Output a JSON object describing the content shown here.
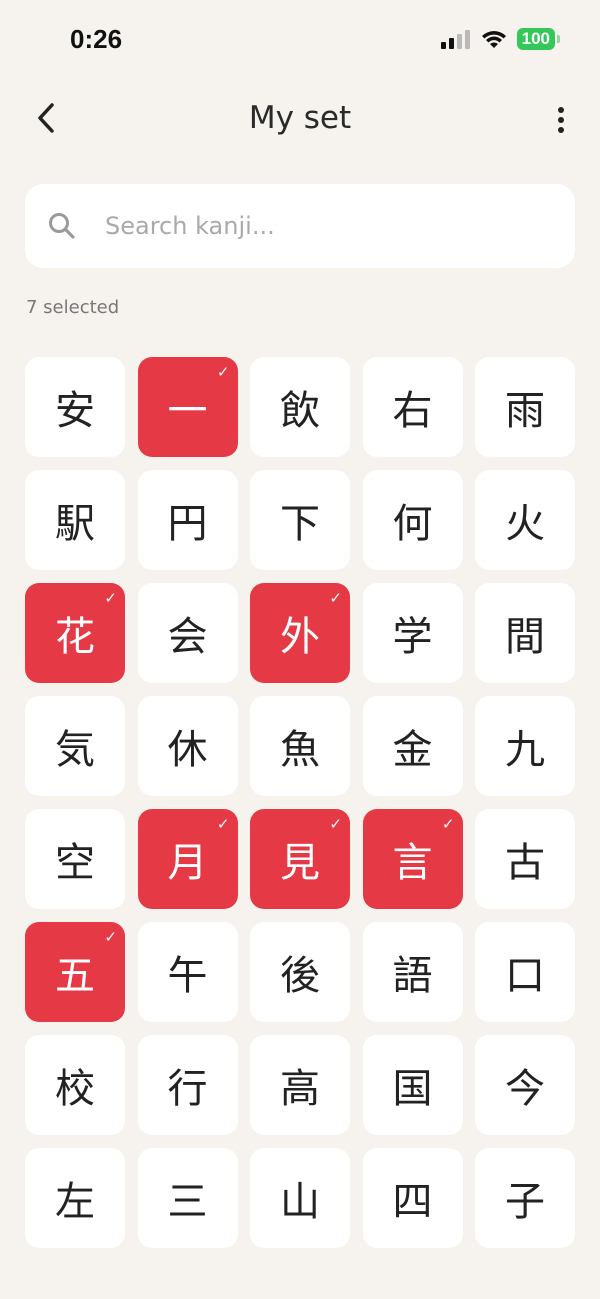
{
  "status": {
    "time": "0:26",
    "battery": "100"
  },
  "header": {
    "title": "My set"
  },
  "search": {
    "placeholder": "Search kanji..."
  },
  "selection": {
    "count_text": "7 selected"
  },
  "kanji": [
    {
      "char": "安",
      "selected": false
    },
    {
      "char": "一",
      "selected": true
    },
    {
      "char": "飲",
      "selected": false
    },
    {
      "char": "右",
      "selected": false
    },
    {
      "char": "雨",
      "selected": false
    },
    {
      "char": "駅",
      "selected": false
    },
    {
      "char": "円",
      "selected": false
    },
    {
      "char": "下",
      "selected": false
    },
    {
      "char": "何",
      "selected": false
    },
    {
      "char": "火",
      "selected": false
    },
    {
      "char": "花",
      "selected": true
    },
    {
      "char": "会",
      "selected": false
    },
    {
      "char": "外",
      "selected": true
    },
    {
      "char": "学",
      "selected": false
    },
    {
      "char": "間",
      "selected": false
    },
    {
      "char": "気",
      "selected": false
    },
    {
      "char": "休",
      "selected": false
    },
    {
      "char": "魚",
      "selected": false
    },
    {
      "char": "金",
      "selected": false
    },
    {
      "char": "九",
      "selected": false
    },
    {
      "char": "空",
      "selected": false
    },
    {
      "char": "月",
      "selected": true
    },
    {
      "char": "見",
      "selected": true
    },
    {
      "char": "言",
      "selected": true
    },
    {
      "char": "古",
      "selected": false
    },
    {
      "char": "五",
      "selected": true
    },
    {
      "char": "午",
      "selected": false
    },
    {
      "char": "後",
      "selected": false
    },
    {
      "char": "語",
      "selected": false
    },
    {
      "char": "口",
      "selected": false
    },
    {
      "char": "校",
      "selected": false
    },
    {
      "char": "行",
      "selected": false
    },
    {
      "char": "高",
      "selected": false
    },
    {
      "char": "国",
      "selected": false
    },
    {
      "char": "今",
      "selected": false
    },
    {
      "char": "左",
      "selected": false
    },
    {
      "char": "三",
      "selected": false
    },
    {
      "char": "山",
      "selected": false
    },
    {
      "char": "四",
      "selected": false
    },
    {
      "char": "子",
      "selected": false
    }
  ],
  "check_mark": "✓",
  "colors": {
    "accent": "#e63946",
    "background": "#f6f3ee",
    "tile": "#ffffff",
    "battery": "#34c759"
  },
  "icons": {
    "back": "chevron-left-icon",
    "more": "more-vertical-icon",
    "search": "search-icon",
    "signal": "signal-icon",
    "wifi": "wifi-icon",
    "battery": "battery-icon"
  }
}
